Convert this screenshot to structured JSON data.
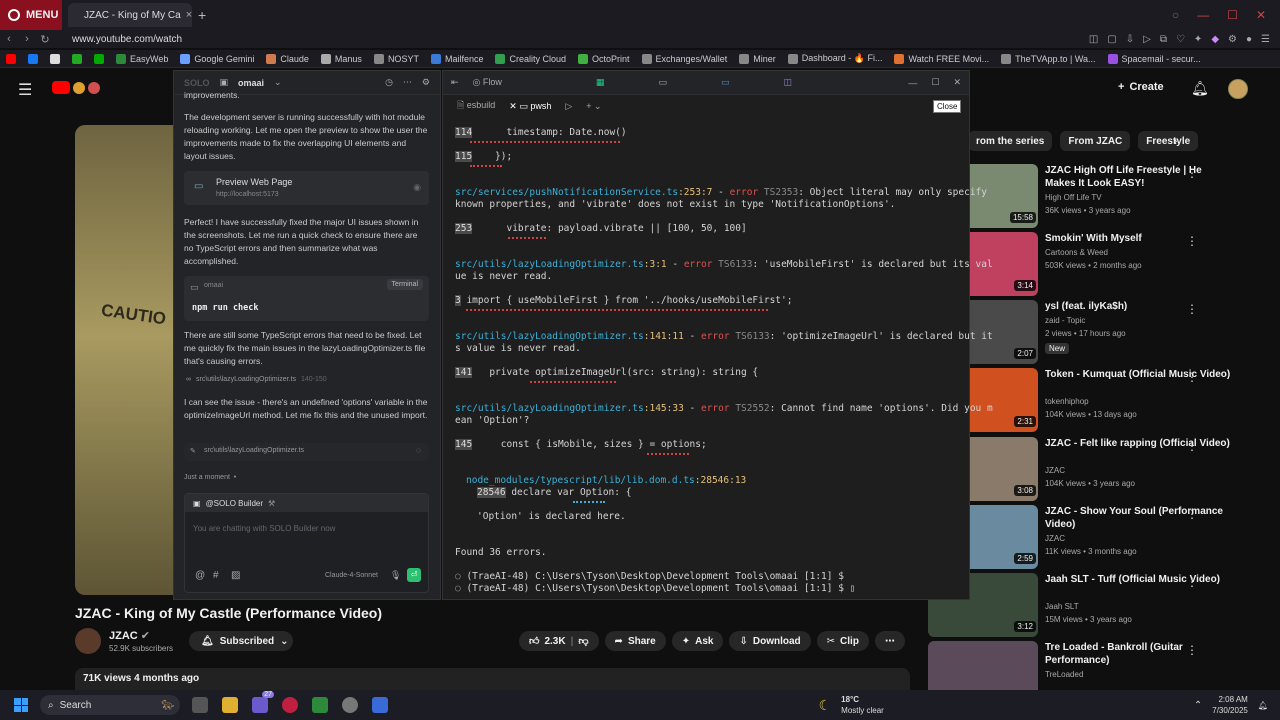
{
  "browser": {
    "menu_label": "MENU",
    "tab_title": "JZAC - King of My Ca",
    "url": "www.youtube.com/watch"
  },
  "bookmarks": [
    {
      "label": "EasyWeb",
      "color": "#2c8a3a"
    },
    {
      "label": "Google Gemini",
      "color": "#6aa0ff"
    },
    {
      "label": "Claude",
      "color": "#d07a50"
    },
    {
      "label": "Manus",
      "color": "#aaaaaa"
    },
    {
      "label": "NOSYT",
      "color": "#888888"
    },
    {
      "label": "Mailfence",
      "color": "#3a7ad8"
    },
    {
      "label": "Creality Cloud",
      "color": "#30a050"
    },
    {
      "label": "OctoPrint",
      "color": "#40b040"
    },
    {
      "label": "Exchanges/Wallet",
      "color": "#888888"
    },
    {
      "label": "Miner",
      "color": "#888888"
    },
    {
      "label": "Dashboard - 🔥 Fi...",
      "color": "#888888"
    },
    {
      "label": "Watch FREE Movi...",
      "color": "#e07030"
    },
    {
      "label": "TheTVApp.to | Wa...",
      "color": "#888888"
    },
    {
      "label": "Spacemail - secur...",
      "color": "#9a50e0"
    }
  ],
  "youtube": {
    "create_label": "Create",
    "video_title": "JZAC - King of My Castle (Performance Video)",
    "overlay_text": "CAUTIO",
    "channel": "JZAC",
    "subscribers": "52.9K subscribers",
    "subscribed_label": "Subscribed",
    "likes": "2.3K",
    "share": "Share",
    "ask": "Ask",
    "download": "Download",
    "clip": "Clip",
    "views_line": "71K views  4 months ago",
    "chips": [
      "rom the series",
      "From JZAC",
      "Freestyle"
    ],
    "recommendations": [
      {
        "title": "JZAC High Off Life Freestyle | He Makes It Look EASY!",
        "channel": "High Off Life TV",
        "meta": "36K views • 3 years ago",
        "duration": "15:58",
        "thumb": "#7a8a70"
      },
      {
        "title": "Smokin' With Myself",
        "channel": "Cartoons & Weed",
        "meta": "503K views • 2 months ago",
        "duration": "3:14",
        "thumb": "#c04060"
      },
      {
        "title": "ysl (feat. ilyKa$h)",
        "channel": "zaid - Topic",
        "meta": "2 views • 17 hours ago",
        "duration": "2:07",
        "badge": "New",
        "thumb": "#4a4a4a"
      },
      {
        "title": "Token - Kumquat (Official Music Video)",
        "channel": "tokenhiphop",
        "meta": "104K views • 13 days ago",
        "duration": "2:31",
        "thumb": "#d05020"
      },
      {
        "title": "JZAC - Felt like rapping (Official Video)",
        "channel": "JZAC",
        "meta": "104K views • 3 years ago",
        "duration": "3:08",
        "thumb": "#8a7a6a"
      },
      {
        "title": "JZAC - Show Your Soul (Performance Video)",
        "channel": "JZAC",
        "meta": "11K views • 3 months ago",
        "duration": "2:59",
        "thumb": "#6a8aa0"
      },
      {
        "title": "Jaah SLT - Tuff (Official Music Video)",
        "channel": "Jaah SLT",
        "meta": "15M views • 3 years ago",
        "duration": "3:12",
        "thumb": "#3a4a3a"
      },
      {
        "title": "Tre Loaded - Bankroll (Guitar Performance)",
        "channel": "TreLoaded",
        "meta": "",
        "duration": "",
        "thumb": "#5a4a5a"
      }
    ]
  },
  "solo": {
    "brand": "SOLO",
    "project": "omaai",
    "p0": "improvements.",
    "p1": "The development server is running successfully with hot module reloading working. Let me open the preview to show the user the improvements made to fix the overlapping UI elements and layout issues.",
    "preview_title": "Preview Web Page",
    "preview_url": "http://localhost:5173",
    "p2": "Perfect! I have successfully fixed the major UI issues shown in the screenshots. Let me run a quick check to ensure there are no TypeScript errors and then summarize what was accomplished.",
    "cmd_project": "omaai",
    "cmd_label": "Terminal",
    "cmd": "npm run check",
    "p3": "There are still some TypeScript errors that need to be fixed. Let me quickly fix the main issues in the lazyLoadingOptimizer.ts file that's causing errors.",
    "ref1": "src\\utils\\lazyLoadingOptimizer.ts",
    "ref1_lines": "140-150",
    "p4": "I can see the issue - there's an undefined 'options' variable in the optimizeImageUrl method. Let me fix this and the unused import.",
    "ref2": "src\\utils\\lazyLoadingOptimizer.ts",
    "status": "Just a moment",
    "builder": "@SOLO Builder",
    "input_placeholder": "You are chatting with SOLO Builder now",
    "model": "Claude-4-Sonnet"
  },
  "terminal": {
    "flow": "Flow",
    "tab1": "esbuild",
    "tab2": "pwsh",
    "close_tip": "Close",
    "l114_num": "114",
    "l114": "      timestamp: Date.now()",
    "l115_num": "115",
    "l115": "    });",
    "e1_file": "src/services/pushNotificationService.ts",
    "e1_loc": ":253:7",
    "e1_code": "TS2353",
    "e1_msg1": ": Object literal may only specify",
    "e1_msg2": "known properties, and 'vibrate' does not exist in type 'NotificationOptions'.",
    "l253_num": "253",
    "l253": "      vibrate: payload.vibrate || [100, 50, 100]",
    "e2_file": "src/utils/lazyLoadingOptimizer.ts",
    "e2_loc": ":3:1",
    "e2_code": "TS6133",
    "e2_msg1": ": 'useMobileFirst' is declared but its val",
    "e2_msg2": "ue is never read.",
    "l3_num": "3",
    "l3": " import { useMobileFirst } from '../hooks/useMobileFirst';",
    "e3_file": "src/utils/lazyLoadingOptimizer.ts",
    "e3_loc": ":141:11",
    "e3_code": "TS6133",
    "e3_msg1": ": 'optimizeImageUrl' is declared but it",
    "e3_msg2": "s value is never read.",
    "l141_num": "141",
    "l141": "   private optimizeImageUrl(src: string): string {",
    "e4_file": "src/utils/lazyLoadingOptimizer.ts",
    "e4_loc": ":145:33",
    "e4_code": "TS2552",
    "e4_msg1": ": Cannot find name 'options'. Did you m",
    "e4_msg2": "ean 'Option'?",
    "l145_num": "145",
    "l145": "     const { isMobile, sizes } = options;",
    "n_file": "node_modules/typescript/lib/lib.dom.d.ts",
    "n_loc": ":28546:13",
    "l28546_num": "28546",
    "l28546": " declare var Option: {",
    "n_msg": "'Option' is declared here.",
    "found": "Found 36 errors.",
    "prompt1": "(TraeAI-48) C:\\Users\\Tyson\\Desktop\\Development Tools\\omaai [1:1] $",
    "prompt2": "(TraeAI-48) C:\\Users\\Tyson\\Desktop\\Development Tools\\omaai [1:1] $",
    "error_word": "error"
  },
  "taskbar": {
    "search": "Search",
    "badge": "27",
    "temp": "18°C",
    "weather": "Mostly clear",
    "time": "2:08 AM",
    "date": "7/30/2025"
  }
}
